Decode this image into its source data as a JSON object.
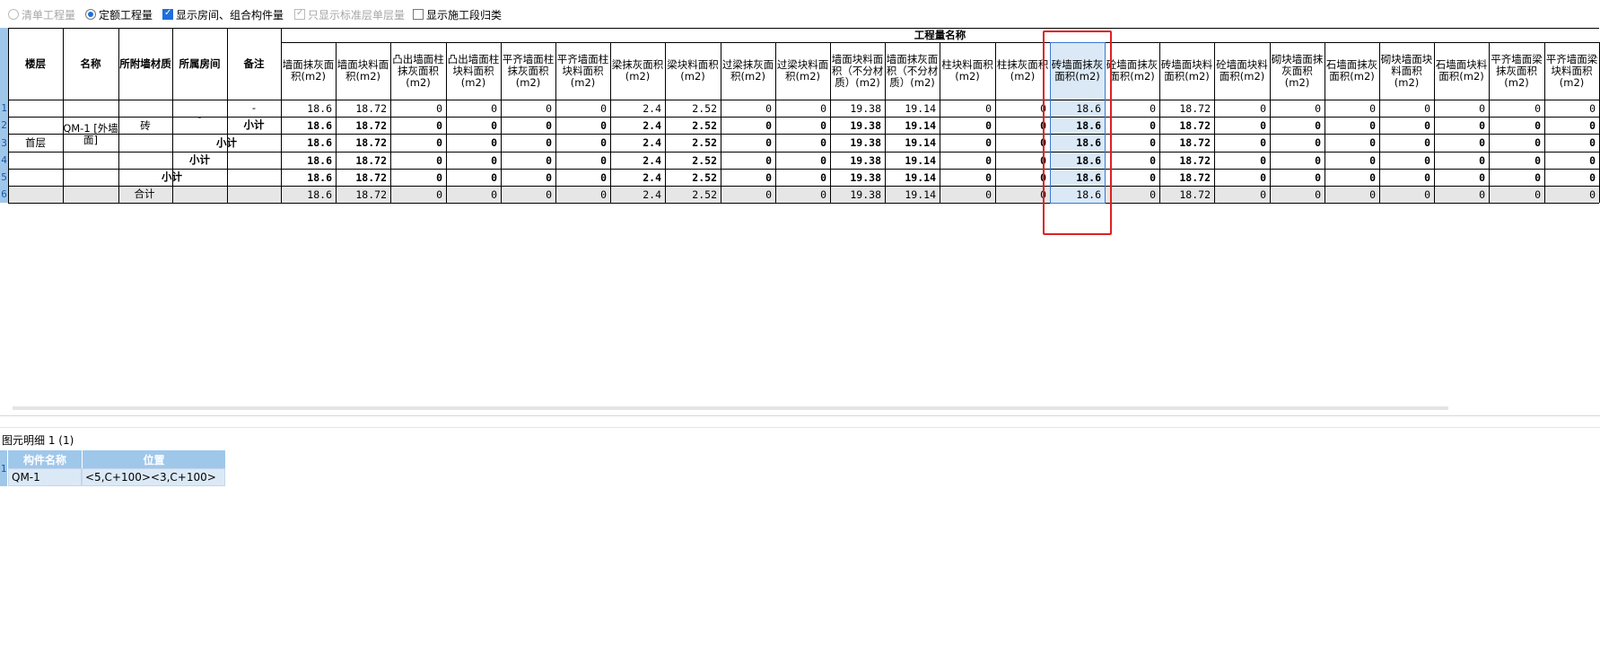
{
  "options": [
    {
      "label": "清单工程量",
      "type": "radio",
      "checked": false,
      "disabled": true
    },
    {
      "label": "定额工程量",
      "type": "radio",
      "checked": true,
      "disabled": false
    },
    {
      "label": "显示房间、组合构件量",
      "type": "checkbox",
      "checked": true,
      "disabled": false
    },
    {
      "label": "只显示标准层单层量",
      "type": "checkbox",
      "checked": true,
      "disabled": true
    },
    {
      "label": "显示施工段归类",
      "type": "checkbox",
      "checked": false,
      "disabled": false
    }
  ],
  "table": {
    "group_header": "工程量名称",
    "fixed_headers": [
      "楼层",
      "名称",
      "所附墙材质",
      "所属房间",
      "备注"
    ],
    "columns": [
      "墙面抹灰面积(m2)",
      "墙面块料面积(m2)",
      "凸出墙面柱抹灰面积(m2)",
      "凸出墙面柱块料面积(m2)",
      "平齐墙面柱抹灰面积(m2)",
      "平齐墙面柱块料面积(m2)",
      "梁抹灰面积(m2)",
      "梁块料面积(m2)",
      "过梁抹灰面积(m2)",
      "过梁块料面积(m2)",
      "墙面块料面积（不分材质）(m2)",
      "墙面抹灰面积（不分材质）(m2)",
      "柱块料面积(m2)",
      "柱抹灰面积(m2)",
      "砖墙面抹灰面积(m2)",
      "砼墙面抹灰面积(m2)",
      "砖墙面块料面积(m2)",
      "砼墙面块料面积(m2)",
      "砌块墙面抹灰面积(m2)",
      "石墙面抹灰面积(m2)",
      "砌块墙面块料面积(m2)",
      "石墙面块料面积(m2)",
      "平齐墙面梁抹灰面积(m2)",
      "平齐墙面梁块料面积(m2)"
    ],
    "row_numbers": [
      "1",
      "2",
      "3",
      "4",
      "5",
      "6"
    ],
    "floor": "首层",
    "name": "QM-1 [外墙面]",
    "material": "砖",
    "room": "-",
    "remark": "-",
    "subtotal": "小计",
    "total": "合计",
    "rows": [
      [
        "18.6",
        "18.72",
        "0",
        "0",
        "0",
        "0",
        "2.4",
        "2.52",
        "0",
        "0",
        "19.38",
        "19.14",
        "0",
        "0",
        "18.6",
        "0",
        "18.72",
        "0",
        "0",
        "0",
        "0",
        "0",
        "0",
        "0"
      ],
      [
        "18.6",
        "18.72",
        "0",
        "0",
        "0",
        "0",
        "2.4",
        "2.52",
        "0",
        "0",
        "19.38",
        "19.14",
        "0",
        "0",
        "18.6",
        "0",
        "18.72",
        "0",
        "0",
        "0",
        "0",
        "0",
        "0",
        "0"
      ],
      [
        "18.6",
        "18.72",
        "0",
        "0",
        "0",
        "0",
        "2.4",
        "2.52",
        "0",
        "0",
        "19.38",
        "19.14",
        "0",
        "0",
        "18.6",
        "0",
        "18.72",
        "0",
        "0",
        "0",
        "0",
        "0",
        "0",
        "0"
      ],
      [
        "18.6",
        "18.72",
        "0",
        "0",
        "0",
        "0",
        "2.4",
        "2.52",
        "0",
        "0",
        "19.38",
        "19.14",
        "0",
        "0",
        "18.6",
        "0",
        "18.72",
        "0",
        "0",
        "0",
        "0",
        "0",
        "0",
        "0"
      ],
      [
        "18.6",
        "18.72",
        "0",
        "0",
        "0",
        "0",
        "2.4",
        "2.52",
        "0",
        "0",
        "19.38",
        "19.14",
        "0",
        "0",
        "18.6",
        "0",
        "18.72",
        "0",
        "0",
        "0",
        "0",
        "0",
        "0",
        "0"
      ],
      [
        "18.6",
        "18.72",
        "0",
        "0",
        "0",
        "0",
        "2.4",
        "2.52",
        "0",
        "0",
        "19.38",
        "19.14",
        "0",
        "0",
        "18.6",
        "0",
        "18.72",
        "0",
        "0",
        "0",
        "0",
        "0",
        "0",
        "0"
      ]
    ]
  },
  "detail": {
    "title": "图元明细  1 (1)",
    "headers": [
      "构件名称",
      "位置"
    ],
    "row_number": "1",
    "row": [
      "QM-1",
      "<5,C+100><3,C+100>"
    ]
  },
  "colors": {
    "accent": "#1e6fd9",
    "header_blue": "#9fc7ea",
    "highlight": "#e02020",
    "selected_col": "#dbe9f7"
  }
}
